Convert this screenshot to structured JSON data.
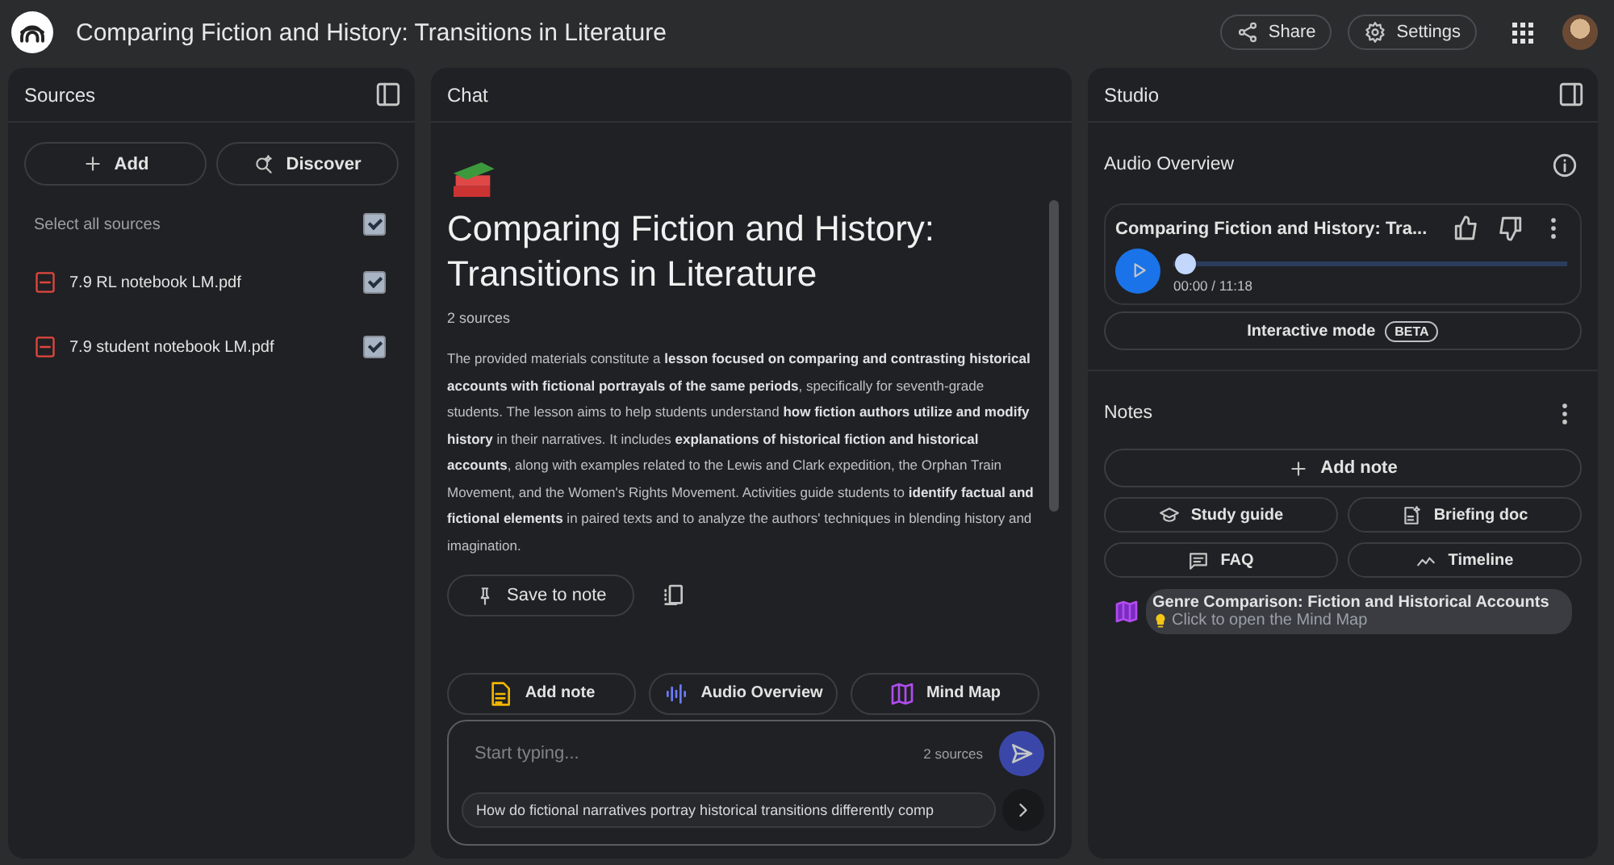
{
  "app_bar": {
    "title": "Comparing Fiction and History: Transitions in Literature",
    "buttons": [
      {
        "kind": "share",
        "label": "Share"
      },
      {
        "kind": "settings",
        "label": "Settings"
      }
    ]
  },
  "sources": {
    "title": "Sources",
    "buttons": [
      {
        "kind": "add",
        "label": "Add"
      },
      {
        "kind": "discover",
        "label": "Discover"
      }
    ],
    "select_all": {
      "label": "Select all sources",
      "checked": true
    },
    "items": [
      {
        "name": "7.9 RL notebook LM.pdf",
        "checked": true
      },
      {
        "name": "7.9 student notebook LM.pdf",
        "checked": true
      }
    ]
  },
  "chat": {
    "title": "Chat",
    "heading": "Comparing Fiction and History: Transitions in Literature",
    "source_count": "2 sources",
    "summary": "The provided materials constitute a **lesson focused on comparing and contrasting historical accounts with fictional portrayals of the same periods**, specifically for seventh-grade students. The lesson aims to help students understand **how fiction authors utilize and modify history** in their narratives. It includes **explanations of historical fiction and historical accounts**, along with examples related to the Lewis and Clark expedition, the Orphan Train Movement, and the Women's Rights Movement. Activities guide students to **identify factual and fictional elements** in paired texts and to analyze the authors' techniques in blending history and imagination.",
    "save_button": "Save to note",
    "actions": [
      {
        "kind": "note",
        "label": "Add note"
      },
      {
        "kind": "audio",
        "label": "Audio Overview"
      },
      {
        "kind": "mindmap",
        "label": "Mind Map"
      }
    ],
    "input": {
      "placeholder": "Start typing...",
      "source_count": "2 sources"
    },
    "suggestion": "How do fictional narratives portray historical transitions differently comp"
  },
  "studio": {
    "title": "Studio",
    "audio_overview": {
      "title": "Audio Overview",
      "player": {
        "title": "Comparing Fiction and History: Tra...",
        "level": 0,
        "time": "00:00 / 11:18"
      },
      "interactive_button": "Interactive mode",
      "badge": "BETA"
    },
    "notes": {
      "title": "Notes",
      "add_button": "Add note",
      "buttons": [
        {
          "kind": "study",
          "label": "Study guide"
        },
        {
          "kind": "briefing",
          "label": "Briefing doc"
        },
        {
          "kind": "faq",
          "label": "FAQ"
        },
        {
          "kind": "timeline",
          "label": "Timeline"
        }
      ],
      "items": [
        {
          "title": "Genre Comparison: Fiction and Historical Accounts",
          "subtitle": "Click to open the Mind Map"
        }
      ]
    }
  }
}
